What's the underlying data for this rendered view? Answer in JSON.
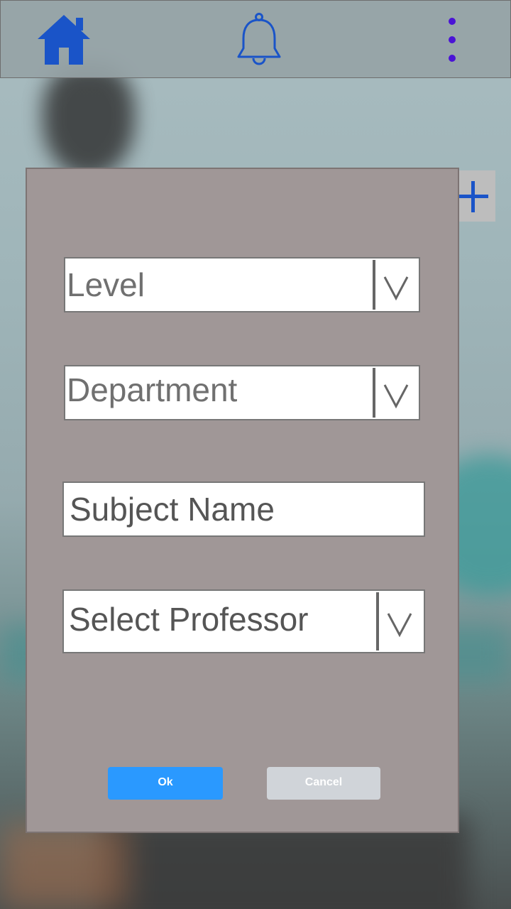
{
  "topbar": {
    "home_icon": "home-icon",
    "bell_icon": "bell-icon",
    "more_icon": "more-vertical-icon"
  },
  "add_icon": "plus-icon",
  "dialog": {
    "level_placeholder": "Level",
    "department_placeholder": "Department",
    "subject_placeholder": "Subject Name",
    "professor_placeholder": "Select Professor",
    "ok_label": "Ok",
    "cancel_label": "Cancel"
  },
  "colors": {
    "accent": "#1a54c8",
    "ok_button": "#2a99ff",
    "cancel_button": "#d0d4d9",
    "dialog_bg": "#a09797"
  }
}
